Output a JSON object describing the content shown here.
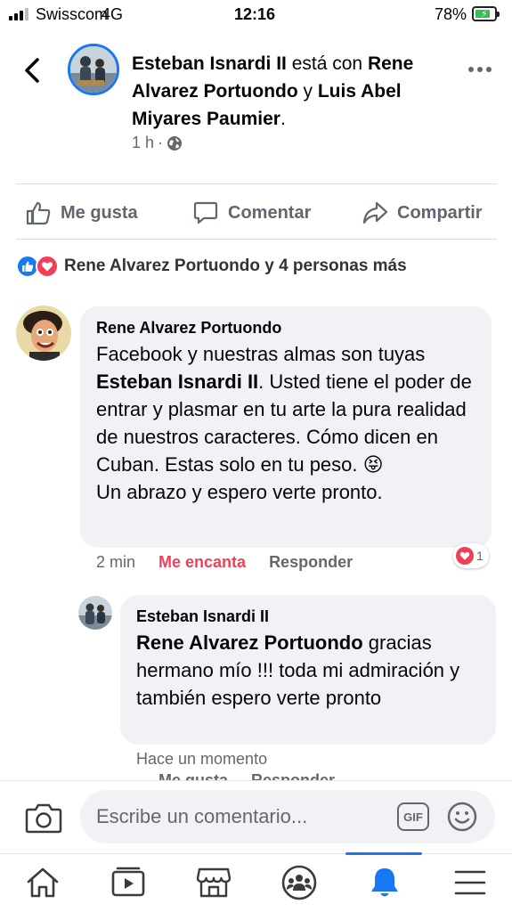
{
  "status_bar": {
    "carrier": "Swisscom",
    "network": "4G",
    "time": "12:16",
    "battery_percent": "78%",
    "battery_level": 0.78
  },
  "post": {
    "author": "Esteban Isnardi II",
    "with_text": " está con ",
    "tagged_1": "Rene Alvarez Portuondo",
    "connector": " y ",
    "tagged_2": "Luis Abel Miyares Paumier",
    "period": ".",
    "time": "1 h",
    "separator": "·",
    "privacy_icon": "globe-icon"
  },
  "actions": {
    "like": "Me gusta",
    "comment": "Comentar",
    "share": "Compartir"
  },
  "reactions": {
    "summary": "Rene Alvarez Portuondo y 4 personas más",
    "icons": [
      "like-icon",
      "love-icon"
    ]
  },
  "comments": [
    {
      "author": "Rene Alvarez Portuondo",
      "text_1": "Facebook y nuestras almas son tuyas",
      "mention": "Esteban Isnardi II",
      "text_2": ". Usted tiene el poder de entrar y plasmar en tu arte la pura realidad de nuestros caracteres. Cómo dicen en Cuban. Estas solo en tu peso. ",
      "emoji": "😝",
      "text_3": "Un abrazo y espero verte pronto.",
      "time": "2 min",
      "reaction_label": "Me encanta",
      "reply_label": "Responder",
      "reaction_count": "1"
    },
    {
      "author": "Esteban Isnardi II",
      "mention": "Rene Alvarez Portuondo",
      "text": " gracias hermano mío !!! toda mi admiración y también espero verte pronto",
      "time": "Hace un momento",
      "like_label": "Me gusta",
      "reply_label": "Responder"
    }
  ],
  "composer": {
    "placeholder": "Escribe un comentario...",
    "gif_label": "GIF"
  },
  "tabbar": {
    "items": [
      "home-icon",
      "watch-icon",
      "marketplace-icon",
      "groups-icon",
      "notifications-icon",
      "menu-icon"
    ],
    "active": "notifications-icon"
  },
  "colors": {
    "accent": "#1877f2",
    "love": "#f33e58",
    "bubble": "#f0f2f5",
    "secondary_text": "#65676b"
  }
}
